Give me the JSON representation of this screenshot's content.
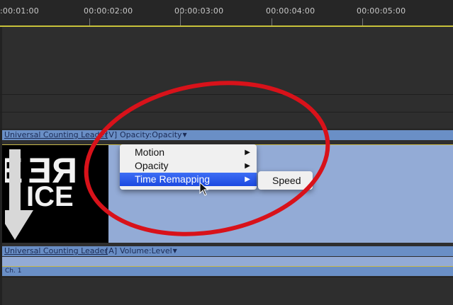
{
  "ruler": {
    "labels": [
      ":00:01:00",
      "00:00:02:00",
      "00:00:03:00",
      "00:00:04:00",
      "00:00:05:00"
    ]
  },
  "video_clip": {
    "name": "Universal Counting Leader",
    "track_tag": "[V]",
    "effect": "Opacity:Opacity"
  },
  "thumbnail": {
    "line1": "RE",
    "line2": "ICE"
  },
  "audio_clip": {
    "name": "Universal Counting Leader",
    "track_tag": "[A]",
    "effect": "Volume:Level",
    "channel": "Ch. 1"
  },
  "context_menu": {
    "items": [
      {
        "label": "Motion"
      },
      {
        "label": "Opacity"
      },
      {
        "label": "Time Remapping"
      }
    ],
    "submenu": {
      "label": "Speed"
    }
  },
  "colors": {
    "menu_highlight": "#2a5cf0",
    "annotation": "#d8121a",
    "clip_header": "#6a8fc6",
    "clip_body": "#93abd6"
  }
}
